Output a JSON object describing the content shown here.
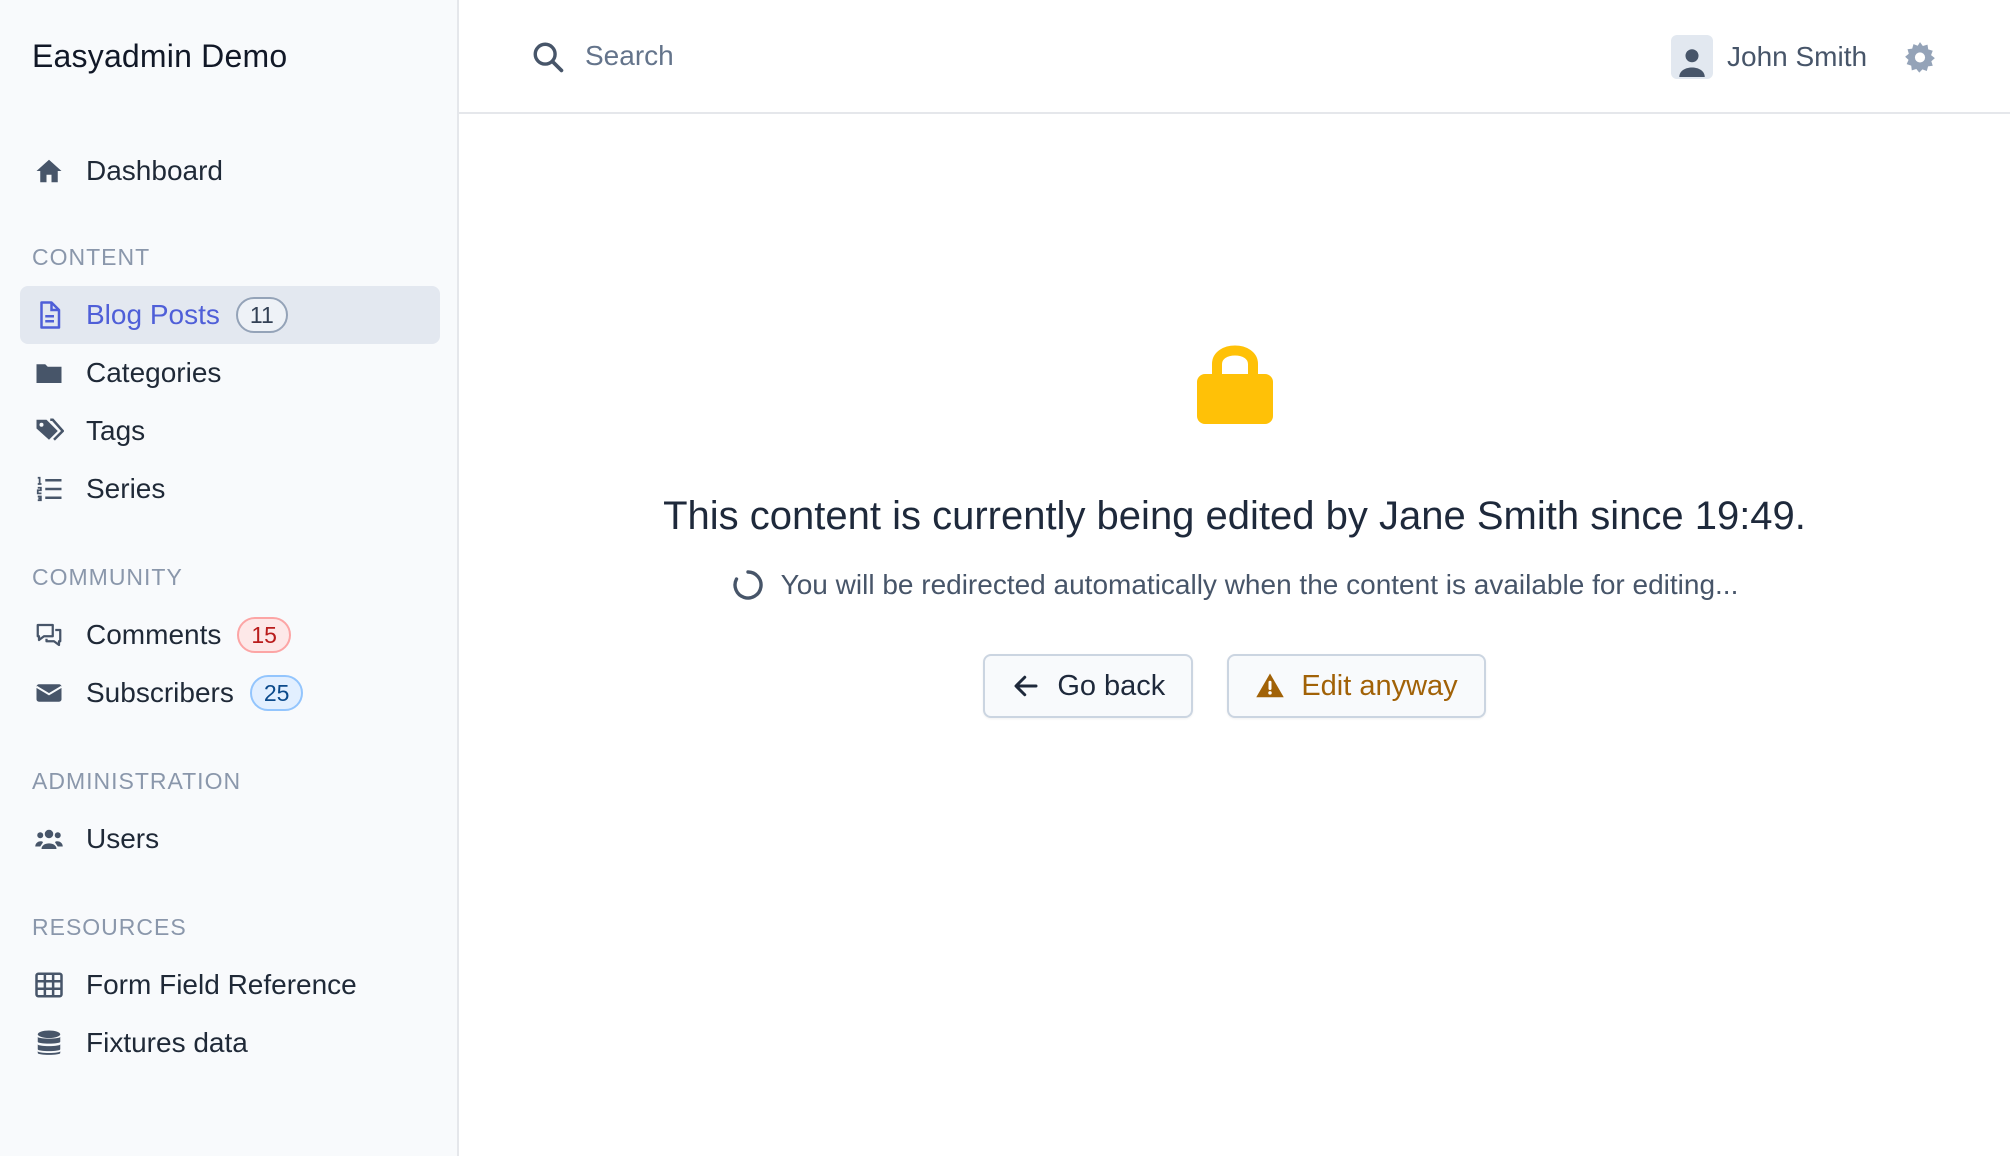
{
  "app": {
    "title": "Easyadmin Demo"
  },
  "sidebar": {
    "dashboard": {
      "label": "Dashboard",
      "icon": "home-icon"
    },
    "sections": [
      {
        "label": "CONTENT"
      },
      {
        "label": "COMMUNITY"
      },
      {
        "label": "ADMINISTRATION"
      },
      {
        "label": "RESOURCES"
      }
    ],
    "items": [
      {
        "label": "Blog Posts",
        "icon": "document-icon",
        "badge": "11",
        "active": true
      },
      {
        "label": "Categories",
        "icon": "folder-icon"
      },
      {
        "label": "Tags",
        "icon": "tags-icon"
      },
      {
        "label": "Series",
        "icon": "numbered-list-icon"
      },
      {
        "label": "Comments",
        "icon": "comments-icon",
        "badge": "15"
      },
      {
        "label": "Subscribers",
        "icon": "envelope-icon",
        "badge": "25"
      },
      {
        "label": "Users",
        "icon": "users-icon"
      },
      {
        "label": "Form Field Reference",
        "icon": "table-icon"
      },
      {
        "label": "Fixtures data",
        "icon": "database-icon"
      }
    ]
  },
  "header": {
    "search_placeholder": "Search",
    "user_name": "John Smith"
  },
  "lock_notice": {
    "message": "This content is currently being edited by Jane Smith since 19:49.",
    "redirect_text": "You will be redirected automatically when the content is available for editing...",
    "back_label": "Go back",
    "edit_label": "Edit anyway"
  },
  "colors": {
    "accent": "#4f5fd8",
    "lock": "#ffc107",
    "warning_text": "#a16207",
    "sidebar_bg": "#f8fafc"
  }
}
